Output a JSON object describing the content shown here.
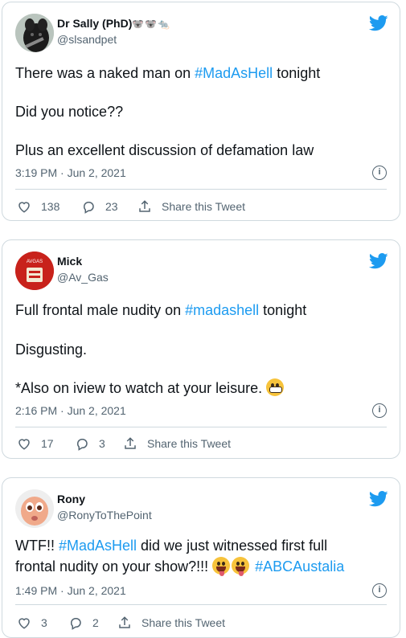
{
  "tweets": [
    {
      "name": "Dr Sally (PhD)",
      "name_emoji": "🐨🐨🐀",
      "handle": "@slsandpet",
      "lines": [
        [
          "There was a naked man on ",
          "#MadAsHell",
          " tonight"
        ],
        [
          "Did you notice??"
        ],
        [
          "Plus an excellent discussion of defamation law"
        ]
      ],
      "time": "3:19 PM · Jun 2, 2021",
      "likes": "138",
      "replies": "23",
      "share_label": "Share this Tweet"
    },
    {
      "name": "Mick",
      "handle": "@Av_Gas",
      "avatar_text": "AVGAS",
      "lines": [
        [
          "Full frontal male nudity on ",
          "#madashell",
          " tonight"
        ],
        [
          "Disgusting."
        ],
        [
          "*Also on iview to watch at your leisure. "
        ]
      ],
      "time": "2:16 PM · Jun 2, 2021",
      "likes": "17",
      "replies": "3",
      "share_label": "Share this Tweet"
    },
    {
      "name": "Rony",
      "handle": "@RonyToThePoint",
      "lines": [
        [
          "WTF!! ",
          "#MadAsHell",
          " did we just witnessed first full"
        ],
        [
          "frontal nudity on your show?!!! ",
          "#ABCAustalia"
        ]
      ],
      "time": "1:49 PM · Jun 2, 2021",
      "likes": "3",
      "replies": "2",
      "share_label": "Share this Tweet"
    }
  ],
  "icons": {
    "twitter": "twitter-bird-icon",
    "info": "info-icon",
    "like": "heart-icon",
    "reply": "reply-icon",
    "share": "share-icon"
  },
  "colors": {
    "accent": "#1d9bf0",
    "text": "#0f1419",
    "muted": "#536471",
    "border": "#cfd9de"
  }
}
